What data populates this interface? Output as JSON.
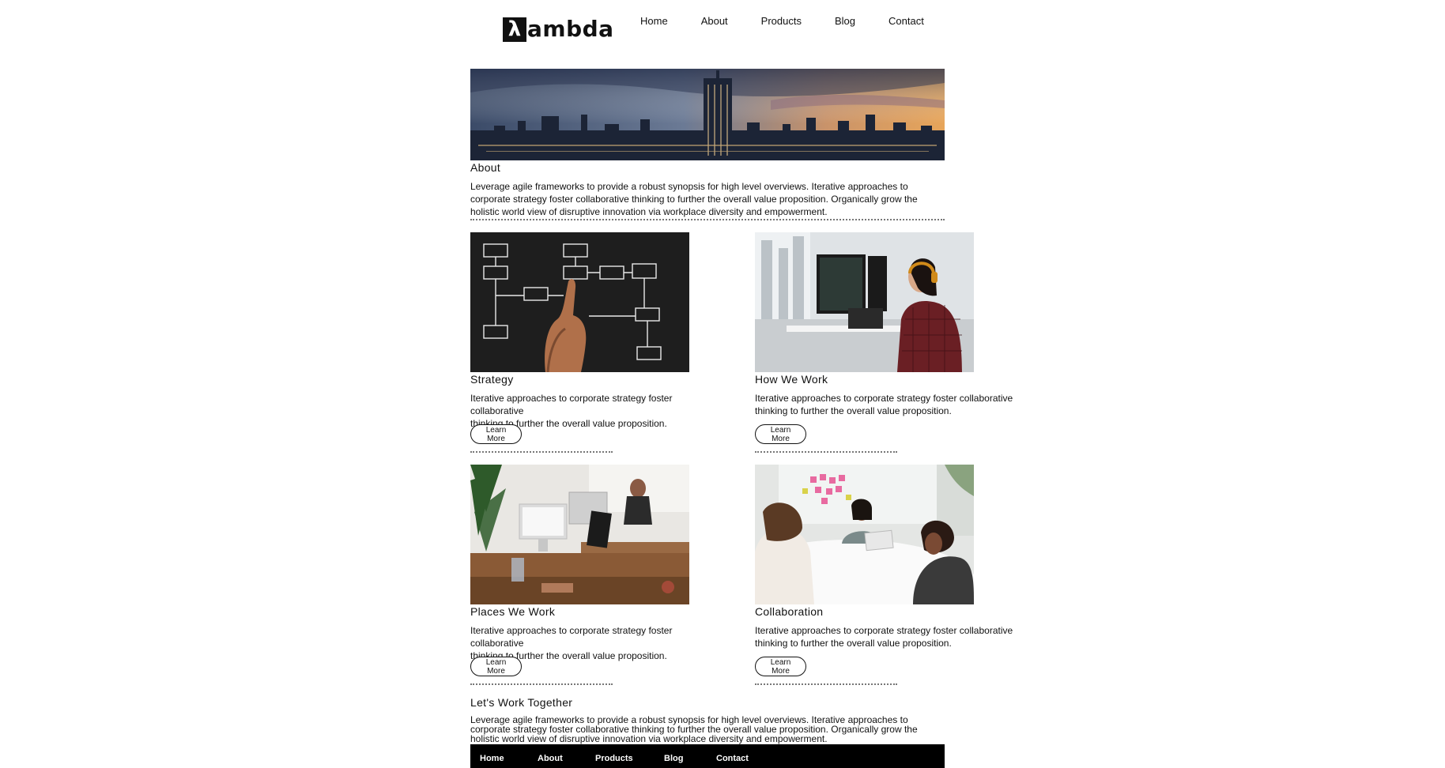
{
  "header": {
    "logo_glyph": "λ",
    "logo_text": "ambda",
    "nav": [
      "Home",
      "About",
      "Products",
      "Blog",
      "Contact"
    ]
  },
  "about": {
    "title": "About",
    "text_lines": [
      "Leverage agile frameworks to provide a robust synopsis for high level overviews. Iterative approaches to",
      "corporate strategy foster collaborative thinking to further the overall value proposition. Organically grow the",
      "holistic world view of disruptive innovation via workplace diversity and empowerment."
    ]
  },
  "cards": [
    {
      "title": "Strategy",
      "image": "flowchart-whiteboard-image",
      "text_lines": [
        "Iterative approaches to corporate strategy foster collaborative",
        "thinking to further the overall value proposition."
      ],
      "button": "Learn More"
    },
    {
      "title": "How We Work",
      "image": "developer-at-monitors-image",
      "text_lines": [
        "Iterative approaches to corporate strategy foster collaborative",
        "thinking to further the overall value proposition."
      ],
      "button": "Learn More"
    },
    {
      "title": "Places We Work",
      "image": "office-desks-image",
      "text_lines": [
        "Iterative approaches to corporate strategy foster collaborative",
        "thinking to further the overall value proposition."
      ],
      "button": "Learn More"
    },
    {
      "title": "Collaboration",
      "image": "team-meeting-image",
      "text_lines": [
        "Iterative approaches to corporate strategy foster collaborative",
        "thinking to further the overall value proposition."
      ],
      "button": "Learn More"
    }
  ],
  "together": {
    "title": "Let's Work Together",
    "text_lines": [
      "Leverage agile frameworks to provide a robust synopsis for high level overviews. Iterative approaches to",
      "corporate strategy foster collaborative thinking to further the overall value proposition. Organically grow the",
      "holistic world view of disruptive innovation via workplace diversity and empowerment."
    ]
  },
  "footer": {
    "nav": [
      "Home",
      "About",
      "Products",
      "Blog",
      "Contact"
    ]
  },
  "colors": {
    "text": "#111111",
    "background": "#ffffff",
    "footer_bg": "#000000"
  }
}
